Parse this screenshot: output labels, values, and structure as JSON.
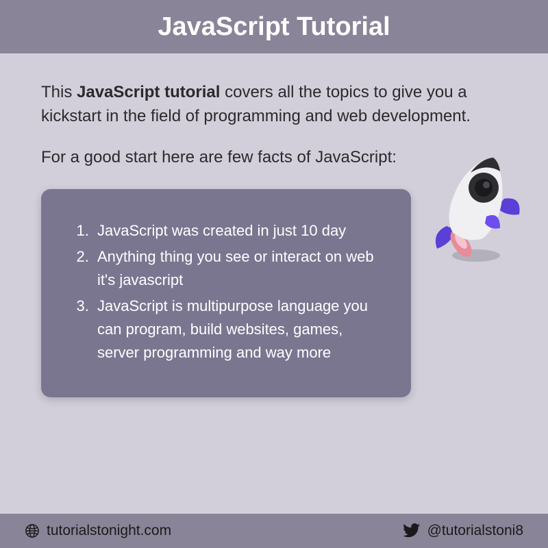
{
  "header": {
    "title": "JavaScript Tutorial"
  },
  "intro": {
    "prefix": "This ",
    "bold": "JavaScript tutorial",
    "rest": " covers all the topics to give you a kickstart in the field of programming and web development."
  },
  "subhead": "For a good start here are few facts of JavaScript:",
  "facts": [
    "JavaScript was created in just 10 day",
    "Anything thing you see or interact on web it's javascript",
    "JavaScript is multipurpose language you can program, build websites, games, server programming and way more"
  ],
  "footer": {
    "website": "tutorialstonight.com",
    "handle": "@tutorialstoni8"
  }
}
